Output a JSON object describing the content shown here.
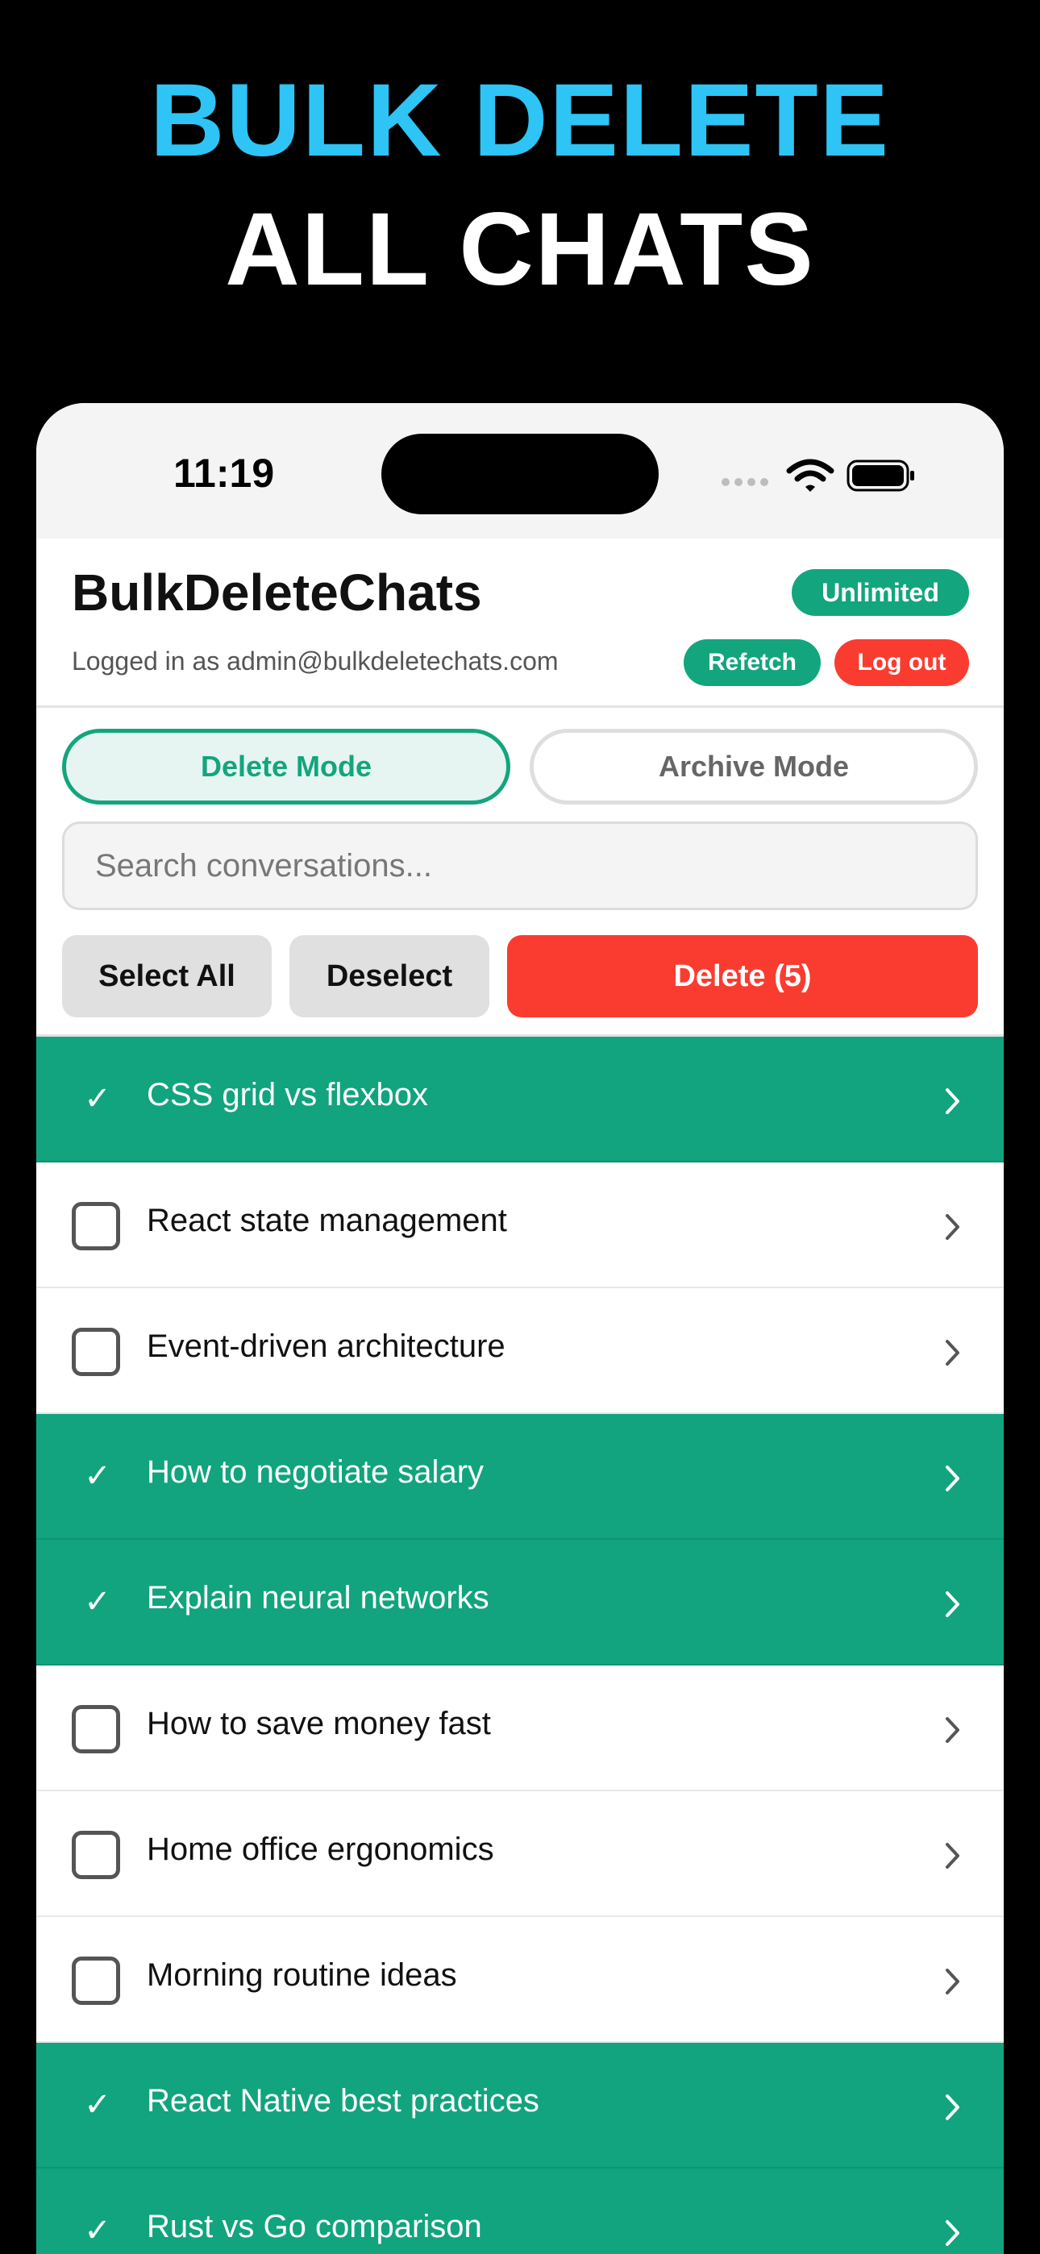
{
  "promo": {
    "line1": "BULK DELETE",
    "line2": "ALL CHATS"
  },
  "status_bar": {
    "time": "11:19"
  },
  "header": {
    "app_title": "BulkDeleteChats",
    "logged_in_text": "Logged in as admin@bulkdeletechats.com",
    "plan_badge": "Unlimited",
    "refetch_label": "Refetch",
    "logout_label": "Log out"
  },
  "modes": {
    "delete_label": "Delete Mode",
    "archive_label": "Archive Mode",
    "active": "delete"
  },
  "search": {
    "placeholder": "Search conversations...",
    "value": ""
  },
  "actions": {
    "select_all_label": "Select All",
    "deselect_label": "Deselect",
    "delete_label": "Delete (5)"
  },
  "colors": {
    "accent_green": "#13a57e",
    "danger_red": "#fa3c30",
    "headline_blue": "#2ec4f5"
  },
  "conversations": [
    {
      "title": "CSS grid vs flexbox",
      "selected": true
    },
    {
      "title": "React state management",
      "selected": false
    },
    {
      "title": "Event-driven architecture",
      "selected": false
    },
    {
      "title": "How to negotiate salary",
      "selected": true
    },
    {
      "title": "Explain neural networks",
      "selected": true
    },
    {
      "title": "How to save money fast",
      "selected": false
    },
    {
      "title": "Home office ergonomics",
      "selected": false
    },
    {
      "title": "Morning routine ideas",
      "selected": false
    },
    {
      "title": "React Native best practices",
      "selected": true
    },
    {
      "title": "Rust vs Go comparison",
      "selected": true
    }
  ]
}
